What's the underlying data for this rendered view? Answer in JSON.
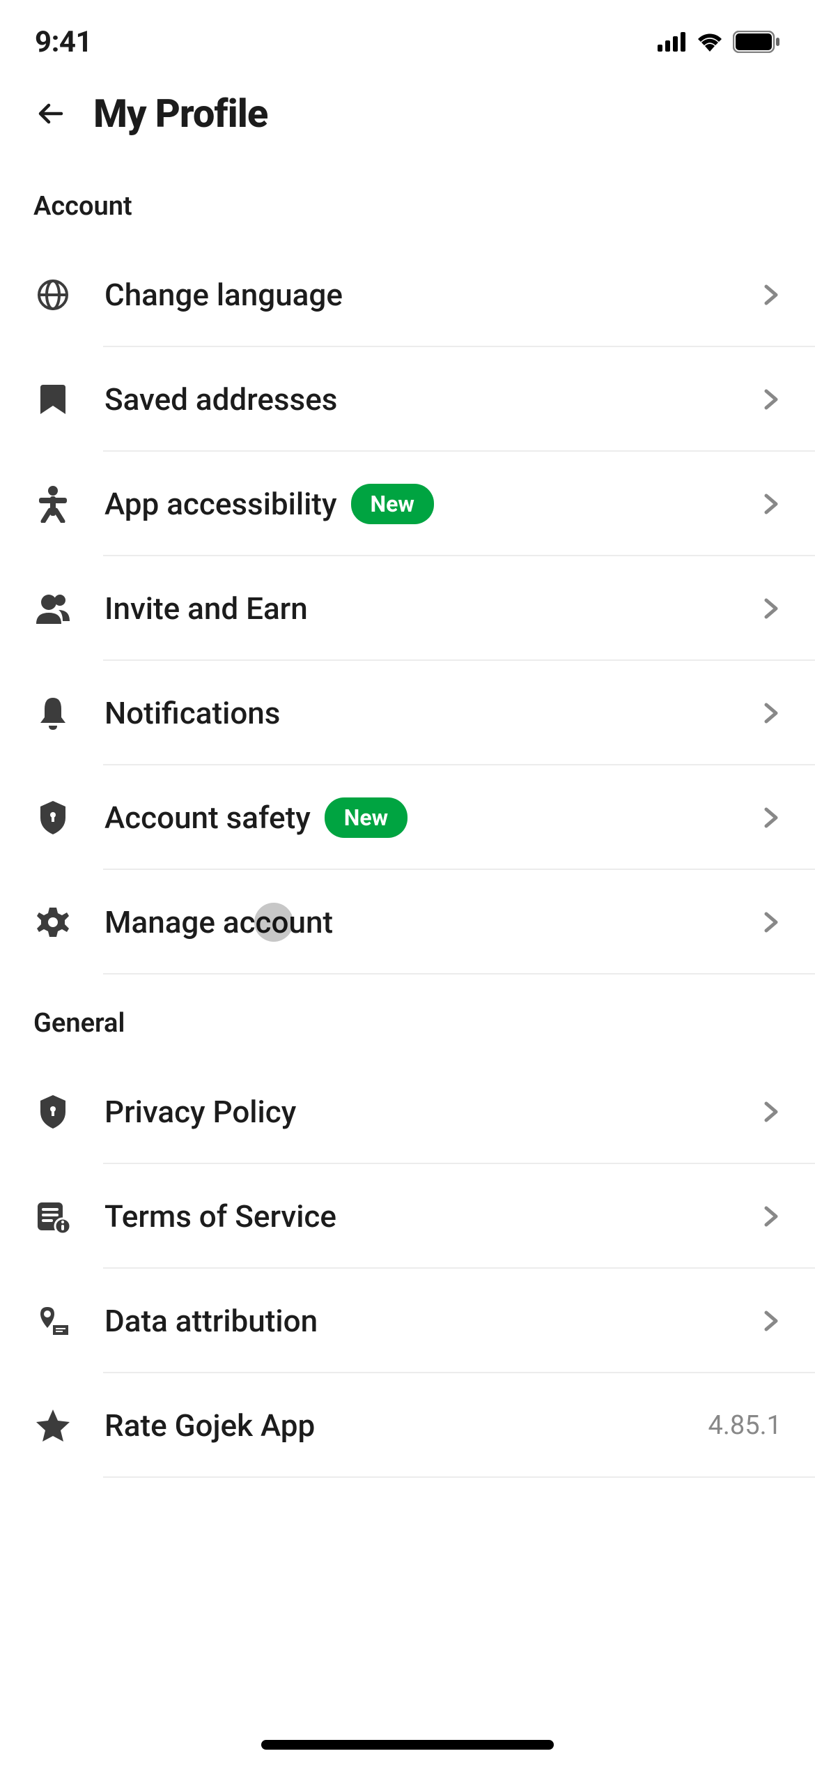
{
  "status": {
    "time": "9:41"
  },
  "header": {
    "title": "My Profile"
  },
  "sections": {
    "account": {
      "title": "Account",
      "items": {
        "change_language": {
          "label": "Change language"
        },
        "saved_addresses": {
          "label": "Saved addresses"
        },
        "app_accessibility": {
          "label": "App accessibility",
          "badge": "New"
        },
        "invite_earn": {
          "label": "Invite and Earn"
        },
        "notifications": {
          "label": "Notifications"
        },
        "account_safety": {
          "label": "Account safety",
          "badge": "New"
        },
        "manage_account": {
          "label": "Manage account"
        }
      }
    },
    "general": {
      "title": "General",
      "items": {
        "privacy_policy": {
          "label": "Privacy Policy"
        },
        "terms_of_service": {
          "label": "Terms of Service"
        },
        "data_attribution": {
          "label": "Data attribution"
        },
        "rate_app": {
          "label": "Rate Gojek App",
          "value": "4.85.1"
        }
      }
    }
  }
}
